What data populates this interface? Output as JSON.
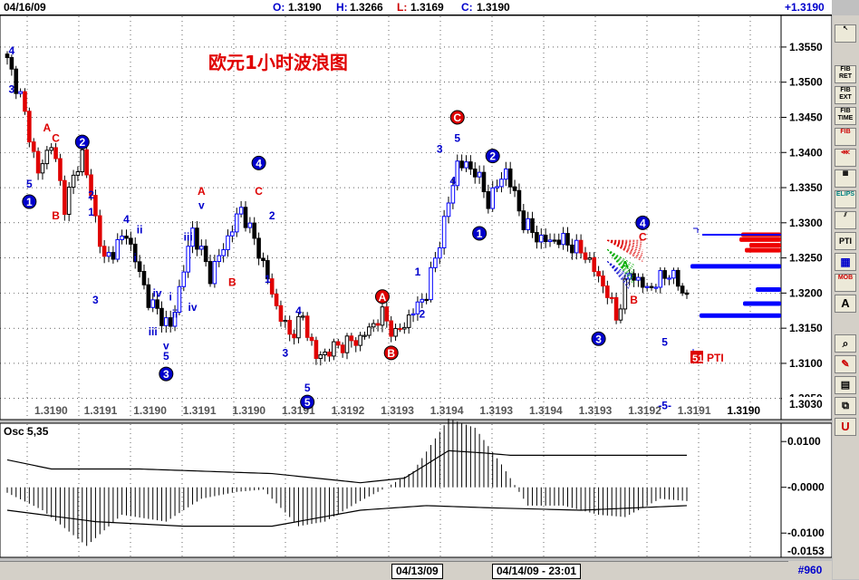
{
  "header": {
    "date": "04/16/09",
    "open_label": "O:",
    "open_value": "1.3190",
    "high_label": "H:",
    "high_value": "1.3266",
    "low_label": "L:",
    "low_value": "1.3169",
    "close_label": "C:",
    "close_value": "1.3190",
    "change": "+1.3190"
  },
  "chart_data": [
    {
      "type": "candlestick",
      "title": "欧元1小时波浪图",
      "ylim": [
        1.302,
        1.3595
      ],
      "yticks": [
        "1.3550",
        "1.3500",
        "1.3450",
        "1.3400",
        "1.3350",
        "1.3300",
        "1.3250",
        "1.3200",
        "1.3150",
        "1.3100",
        "1.3050"
      ],
      "last_price_label": "1.3030",
      "bottom_price_labels": [
        "1.3190",
        "1.3191",
        "1.3190",
        "1.3191",
        "1.3190",
        "1.3191",
        "1.3192",
        "1.3193",
        "1.3194",
        "1.3193",
        "1.3194",
        "1.3193",
        "1.3192",
        "1.3191",
        "1.3190"
      ],
      "pivots": [
        [
          0,
          1.353
        ],
        [
          3,
          1.348
        ],
        [
          7,
          1.337
        ],
        [
          10,
          1.3415
        ],
        [
          13,
          1.3325
        ],
        [
          17,
          1.34
        ],
        [
          22,
          1.3245
        ],
        [
          27,
          1.3285
        ],
        [
          32,
          1.319
        ],
        [
          37,
          1.315
        ],
        [
          42,
          1.329
        ],
        [
          46,
          1.3225
        ],
        [
          49,
          1.3265
        ],
        [
          53,
          1.332
        ],
        [
          57,
          1.326
        ],
        [
          61,
          1.318
        ],
        [
          64,
          1.314
        ],
        [
          67,
          1.3165
        ],
        [
          70,
          1.3108
        ],
        [
          75,
          1.3125
        ],
        [
          80,
          1.3135
        ],
        [
          85,
          1.317
        ],
        [
          88,
          1.314
        ],
        [
          91,
          1.3165
        ],
        [
          95,
          1.32
        ],
        [
          99,
          1.33
        ],
        [
          102,
          1.3385
        ],
        [
          106,
          1.3375
        ],
        [
          109,
          1.333
        ],
        [
          113,
          1.3375
        ],
        [
          117,
          1.33
        ],
        [
          121,
          1.3275
        ],
        [
          126,
          1.3275
        ],
        [
          131,
          1.3255
        ],
        [
          136,
          1.32
        ],
        [
          138,
          1.3165
        ],
        [
          141,
          1.323
        ],
        [
          145,
          1.3205
        ],
        [
          150,
          1.323
        ],
        [
          154,
          1.3195
        ]
      ],
      "wave_labels": [
        {
          "text": "4",
          "bar": 1,
          "price": 1.3545,
          "color": "blue"
        },
        {
          "text": "3",
          "bar": 1,
          "price": 1.349,
          "color": "blue"
        },
        {
          "text": "A",
          "bar": 9,
          "price": 1.3435,
          "color": "red"
        },
        {
          "text": "C",
          "bar": 11,
          "price": 1.342,
          "color": "red"
        },
        {
          "text": "5",
          "bar": 5,
          "price": 1.3355,
          "color": "blue"
        },
        {
          "text": "1",
          "bar": 5,
          "price": 1.333,
          "color": "blue",
          "circled": true
        },
        {
          "text": "B",
          "bar": 11,
          "price": 1.331,
          "color": "red"
        },
        {
          "text": "2",
          "bar": 17,
          "price": 1.3415,
          "color": "blue",
          "circled": true
        },
        {
          "text": "2",
          "bar": 19,
          "price": 1.334,
          "color": "blue"
        },
        {
          "text": "1",
          "bar": 19,
          "price": 1.3315,
          "color": "blue"
        },
        {
          "text": "4",
          "bar": 27,
          "price": 1.3305,
          "color": "blue"
        },
        {
          "text": "ii",
          "bar": 30,
          "price": 1.329,
          "color": "blue"
        },
        {
          "text": "i",
          "bar": 29,
          "price": 1.325,
          "color": "blue"
        },
        {
          "text": "3",
          "bar": 20,
          "price": 1.319,
          "color": "blue"
        },
        {
          "text": "iv",
          "bar": 34,
          "price": 1.32,
          "color": "blue"
        },
        {
          "text": "i",
          "bar": 37,
          "price": 1.3195,
          "color": "blue"
        },
        {
          "text": "iii",
          "bar": 41,
          "price": 1.328,
          "color": "blue"
        },
        {
          "text": "ii",
          "bar": 38,
          "price": 1.317,
          "color": "blue"
        },
        {
          "text": "iv",
          "bar": 42,
          "price": 1.318,
          "color": "blue"
        },
        {
          "text": "iii",
          "bar": 33,
          "price": 1.3145,
          "color": "blue"
        },
        {
          "text": "v",
          "bar": 36,
          "price": 1.3125,
          "color": "blue"
        },
        {
          "text": "5",
          "bar": 36,
          "price": 1.311,
          "color": "blue"
        },
        {
          "text": "3",
          "bar": 36,
          "price": 1.3085,
          "color": "blue",
          "circled": true
        },
        {
          "text": "A",
          "bar": 44,
          "price": 1.3345,
          "color": "red"
        },
        {
          "text": "v",
          "bar": 44,
          "price": 1.3325,
          "color": "blue"
        },
        {
          "text": "4",
          "bar": 57,
          "price": 1.3385,
          "color": "blue",
          "circled": true
        },
        {
          "text": "C",
          "bar": 57,
          "price": 1.3345,
          "color": "red"
        },
        {
          "text": "2",
          "bar": 60,
          "price": 1.331,
          "color": "blue"
        },
        {
          "text": "B",
          "bar": 51,
          "price": 1.3215,
          "color": "red"
        },
        {
          "text": "1",
          "bar": 59,
          "price": 1.322,
          "color": "blue"
        },
        {
          "text": "4",
          "bar": 66,
          "price": 1.3175,
          "color": "blue"
        },
        {
          "text": "3",
          "bar": 63,
          "price": 1.3115,
          "color": "blue"
        },
        {
          "text": "5",
          "bar": 68,
          "price": 1.3065,
          "color": "blue"
        },
        {
          "text": "5",
          "bar": 68,
          "price": 1.3045,
          "color": "blue",
          "circled": true
        },
        {
          "text": "A",
          "bar": 85,
          "price": 1.3195,
          "color": "red",
          "circled": true
        },
        {
          "text": "B",
          "bar": 87,
          "price": 1.3115,
          "color": "red",
          "circled": true
        },
        {
          "text": "1",
          "bar": 93,
          "price": 1.323,
          "color": "blue"
        },
        {
          "text": "2",
          "bar": 94,
          "price": 1.317,
          "color": "blue"
        },
        {
          "text": "C",
          "bar": 102,
          "price": 1.345,
          "color": "red",
          "circled": true
        },
        {
          "text": "5",
          "bar": 102,
          "price": 1.342,
          "color": "blue"
        },
        {
          "text": "3",
          "bar": 98,
          "price": 1.3405,
          "color": "blue"
        },
        {
          "text": "4",
          "bar": 101,
          "price": 1.336,
          "color": "blue"
        },
        {
          "text": "2",
          "bar": 110,
          "price": 1.3395,
          "color": "blue",
          "circled": true
        },
        {
          "text": "1",
          "bar": 107,
          "price": 1.3285,
          "color": "blue",
          "circled": true
        },
        {
          "text": "4",
          "bar": 144,
          "price": 1.33,
          "color": "blue",
          "circled": true
        },
        {
          "text": "C",
          "bar": 144,
          "price": 1.328,
          "color": "red"
        },
        {
          "text": "A",
          "bar": 140,
          "price": 1.324,
          "color": "green"
        },
        {
          "text": "B",
          "bar": 142,
          "price": 1.319,
          "color": "red"
        },
        {
          "text": "3",
          "bar": 134,
          "price": 1.3135,
          "color": "blue",
          "circled": true
        },
        {
          "text": "5",
          "bar": 149,
          "price": 1.313,
          "color": "blue"
        },
        {
          "text": "-5-",
          "bar": 149,
          "price": 1.304,
          "color": "blue"
        }
      ],
      "pti_label": "PTI",
      "pti_value": "51"
    },
    {
      "type": "bar",
      "title": "Osc 5,35",
      "ylim": [
        -0.0153,
        0.014
      ],
      "yticks": [
        "0.0100",
        "-0.0000",
        "-0.0100"
      ],
      "last_value_label": "-0.0153",
      "osc_pivots": [
        [
          0,
          -0.0012
        ],
        [
          8,
          -0.005
        ],
        [
          18,
          -0.0128
        ],
        [
          26,
          -0.006
        ],
        [
          36,
          -0.0075
        ],
        [
          44,
          -0.0025
        ],
        [
          52,
          -0.001
        ],
        [
          58,
          -0.0005
        ],
        [
          66,
          -0.0085
        ],
        [
          72,
          -0.0075
        ],
        [
          80,
          -0.003
        ],
        [
          86,
          0.0
        ],
        [
          92,
          0.0035
        ],
        [
          100,
          0.015
        ],
        [
          106,
          0.013
        ],
        [
          112,
          0.005
        ],
        [
          118,
          -0.004
        ],
        [
          126,
          -0.004
        ],
        [
          134,
          -0.006
        ],
        [
          140,
          -0.0065
        ],
        [
          148,
          -0.0025
        ],
        [
          154,
          -0.003
        ]
      ],
      "upper_line": [
        [
          0,
          0.006
        ],
        [
          10,
          0.004
        ],
        [
          30,
          0.004
        ],
        [
          60,
          0.003
        ],
        [
          80,
          0.001
        ],
        [
          90,
          0.002
        ],
        [
          100,
          0.008
        ],
        [
          108,
          0.0075
        ],
        [
          114,
          0.007
        ],
        [
          154,
          0.007
        ]
      ],
      "lower_line": [
        [
          0,
          -0.005
        ],
        [
          20,
          -0.0075
        ],
        [
          40,
          -0.0085
        ],
        [
          60,
          -0.0085
        ],
        [
          80,
          -0.005
        ],
        [
          95,
          -0.004
        ],
        [
          110,
          -0.0045
        ],
        [
          130,
          -0.005
        ],
        [
          154,
          -0.004
        ]
      ]
    }
  ],
  "footer": {
    "date_left": "04/13/09",
    "date_right": "04/14/09 - 23:01",
    "bar_count": "#960"
  },
  "toolbar": {
    "items": [
      "fib-ret",
      "fib-ext",
      "fib-time",
      "fib-circle",
      "fan",
      "grid",
      "ellipse",
      "pitchfork",
      "PTI",
      "ruler",
      "MOB",
      "A",
      "zoom",
      "eraser",
      "template",
      "copy",
      "U"
    ],
    "labels": {
      "fib_ret": "FIB RET",
      "fib_ext": "FIB EXT",
      "fib_time": "FIB TIME",
      "fib": "FIB",
      "elips": "ELIPS",
      "pti": "PTI",
      "mob": "MOB",
      "text": "A",
      "u": "U"
    }
  }
}
